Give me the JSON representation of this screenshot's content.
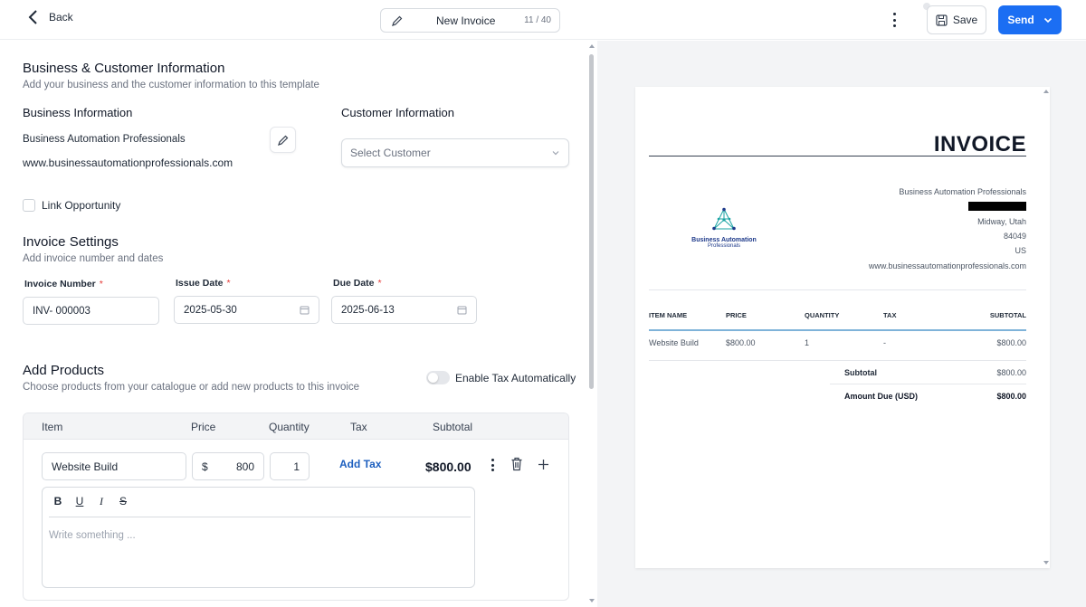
{
  "header": {
    "back_label": "Back",
    "doc_title": "New Invoice",
    "title_count": "11 / 40",
    "save_label": "Save",
    "send_label": "Send"
  },
  "business_customer": {
    "title": "Business & Customer Information",
    "subtitle": "Add your business and the customer information to this template",
    "business_heading": "Business Information",
    "business_name": "Business Automation Professionals",
    "business_url": "www.businessautomationprofessionals.com",
    "customer_heading": "Customer Information",
    "customer_placeholder": "Select Customer",
    "link_opportunity_label": "Link Opportunity"
  },
  "invoice_settings": {
    "title": "Invoice Settings",
    "subtitle": "Add invoice number and dates",
    "invoice_number_label": "Invoice Number",
    "invoice_number_value": "INV- 000003",
    "issue_date_label": "Issue Date",
    "issue_date_value": "2025-05-30",
    "due_date_label": "Due Date",
    "due_date_value": "2025-06-13",
    "required_marker": "*"
  },
  "products": {
    "title": "Add Products",
    "subtitle": "Choose products from your catalogue or add new products to this invoice",
    "tax_toggle_label": "Enable Tax Automatically",
    "tax_toggle_on": false,
    "columns": [
      "Item",
      "Price",
      "Quantity",
      "Tax",
      "Subtotal"
    ],
    "row": {
      "item": "Website Build",
      "currency_symbol": "$",
      "price": "800",
      "quantity": "1",
      "add_tax_label": "Add Tax",
      "subtotal": "$800.00"
    },
    "editor": {
      "tools": [
        "B",
        "U",
        "I",
        "S"
      ],
      "placeholder": "Write something ..."
    }
  },
  "preview": {
    "title": "INVOICE",
    "business_name": "Business Automation Professionals",
    "city_state": "Midway, Utah",
    "zip": "84049",
    "country": "US",
    "url": "www.businessautomationprofessionals.com",
    "logo_line1": "Business Automation",
    "logo_line2": "Professionals",
    "columns": [
      "ITEM NAME",
      "PRICE",
      "QUANTITY",
      "TAX",
      "SUBTOTAL"
    ],
    "row": {
      "name": "Website Build",
      "price": "$800.00",
      "quantity": "1",
      "tax": "-",
      "subtotal": "$800.00"
    },
    "subtotal_label": "Subtotal",
    "subtotal_value": "$800.00",
    "amount_due_label": "Amount Due (USD)",
    "amount_due_value": "$800.00"
  },
  "colors": {
    "accent": "#1b6ef3",
    "required": "#e53935",
    "link": "#1d5fbf",
    "preview_rule": "#7fb3d9"
  }
}
